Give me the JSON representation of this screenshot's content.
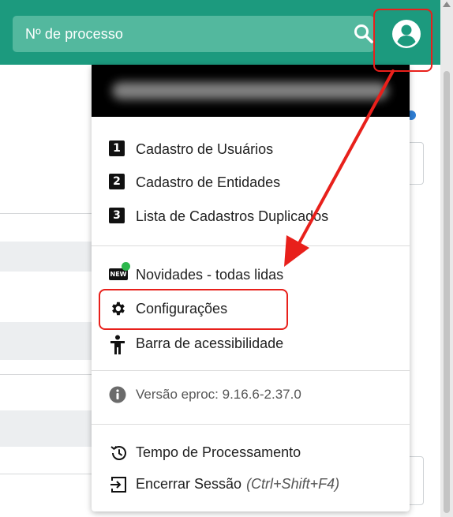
{
  "topbar": {
    "search_placeholder": "Nº de processo",
    "search_icon": "search-icon",
    "avatar_icon": "user-circle-icon",
    "bg_color": "#1c9a7e"
  },
  "menu": {
    "items_group1": [
      {
        "badge": "1",
        "label": "Cadastro de Usuários"
      },
      {
        "badge": "2",
        "label": "Cadastro de Entidades"
      },
      {
        "badge": "3",
        "label": "Lista de Cadastros Duplicados"
      }
    ],
    "items_group2": [
      {
        "icon": "new-badge-icon",
        "badge": "NEW",
        "label": "Novidades - todas lidas"
      },
      {
        "icon": "gear-icon",
        "label": "Configurações"
      },
      {
        "icon": "accessibility-person-icon",
        "label": "Barra de acessibilidade"
      }
    ],
    "version": {
      "icon": "info-icon",
      "label": "Versão eproc: 9.16.6-2.37.0"
    },
    "items_group3": [
      {
        "icon": "history-icon",
        "label": "Tempo de Processamento"
      },
      {
        "icon": "logout-icon",
        "label": "Encerrar Sessão",
        "shortcut": "(Ctrl+Shift+F4)"
      }
    ]
  },
  "annotation_color": "#e8201b"
}
